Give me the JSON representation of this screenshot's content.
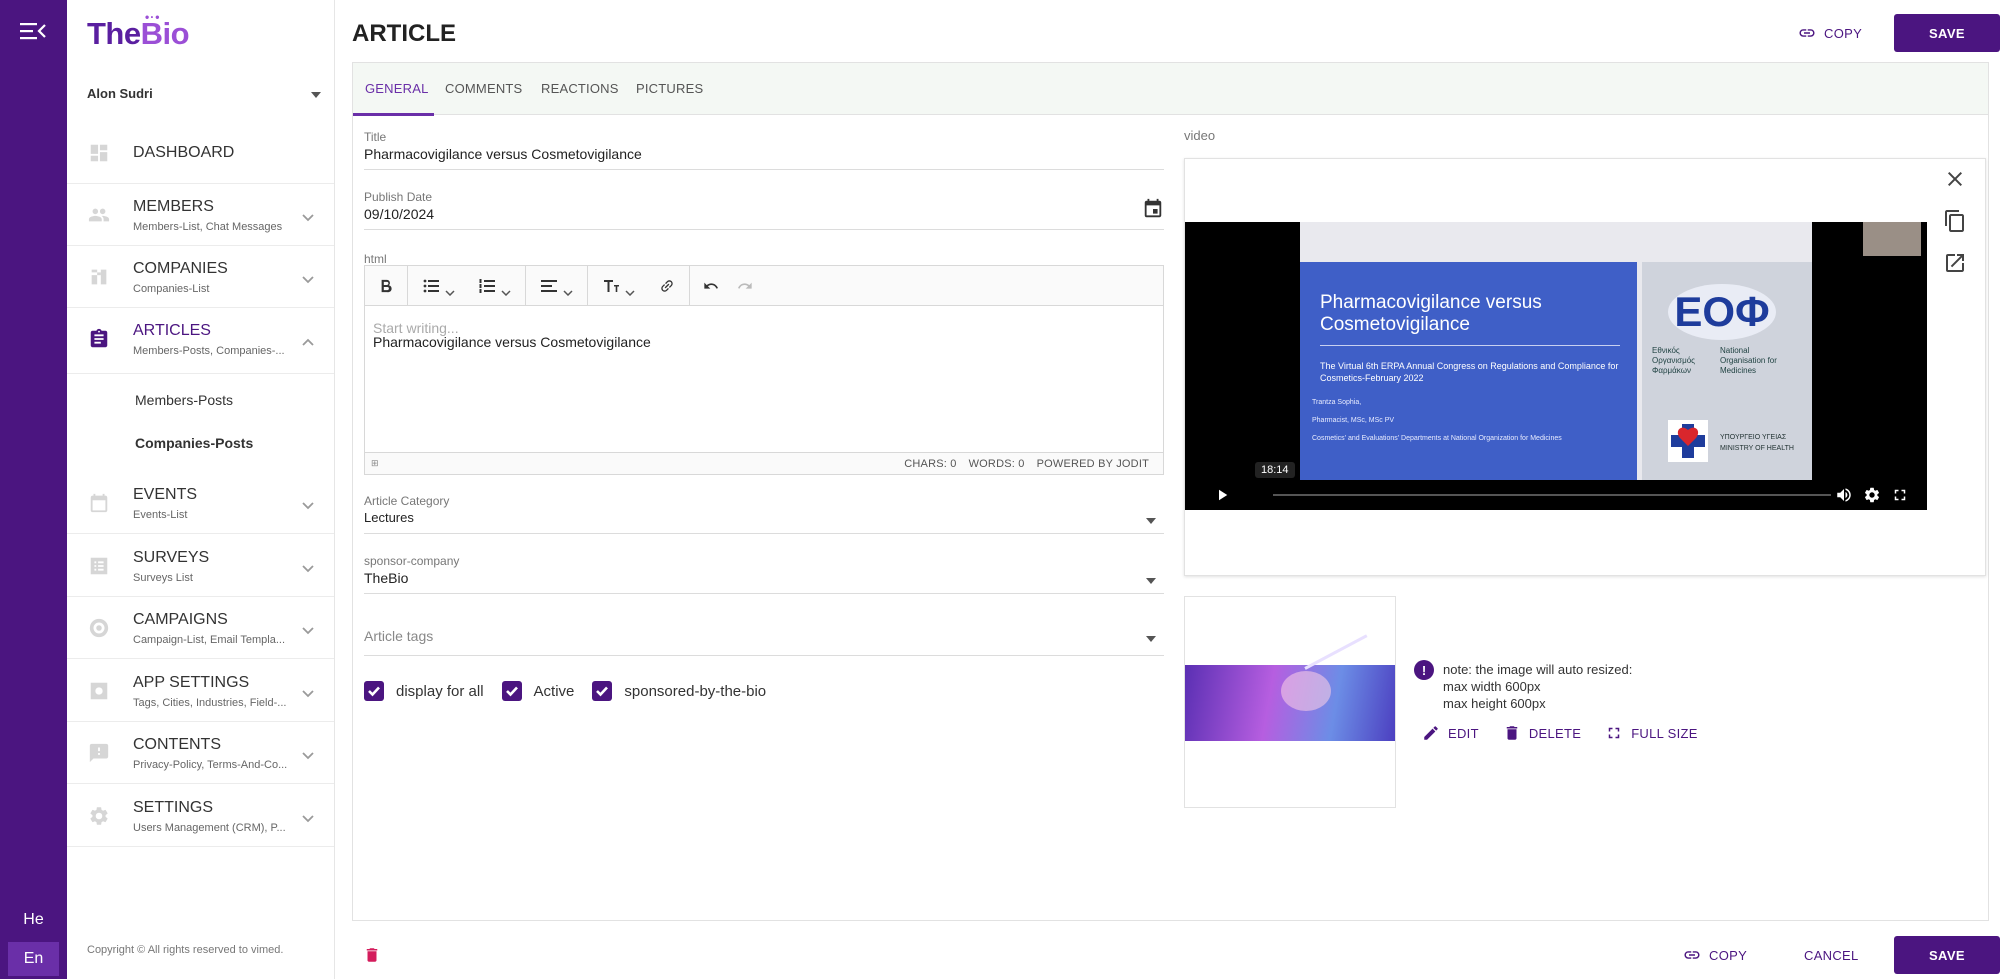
{
  "app": {
    "logo_the": "The",
    "logo_bio": "Bio",
    "user": "Alon Sudri",
    "languages": [
      "He",
      "En"
    ],
    "copyright": "Copyright © All rights reserved to vimed."
  },
  "sidebar": {
    "items": [
      {
        "title": "DASHBOARD",
        "sub": ""
      },
      {
        "title": "MEMBERS",
        "sub": "Members-List, Chat Messages"
      },
      {
        "title": "COMPANIES",
        "sub": "Companies-List"
      },
      {
        "title": "ARTICLES",
        "sub": "Members-Posts, Companies-..."
      },
      {
        "title": "EVENTS",
        "sub": "Events-List"
      },
      {
        "title": "SURVEYS",
        "sub": "Surveys List"
      },
      {
        "title": "CAMPAIGNS",
        "sub": "Campaign-List, Email Templa..."
      },
      {
        "title": "APP SETTINGS",
        "sub": "Tags, Cities, Industries, Field-..."
      },
      {
        "title": "CONTENTS",
        "sub": "Privacy-Policy, Terms-And-Co..."
      },
      {
        "title": "SETTINGS",
        "sub": "Users Management (CRM), P..."
      }
    ],
    "articles_sub": [
      "Members-Posts",
      "Companies-Posts"
    ]
  },
  "page": {
    "title": "ARTICLE",
    "copy_label": "COPY",
    "save_label": "SAVE",
    "cancel_label": "CANCEL"
  },
  "tabs": [
    "GENERAL",
    "COMMENTS",
    "REACTIONS",
    "PICTURES"
  ],
  "form": {
    "title_label": "Title",
    "title_value": "Pharmacovigilance versus Cosmetovigilance",
    "date_label": "Publish Date",
    "date_value": "09/10/2024",
    "html_label": "html",
    "editor_placeholder": "Start writing...",
    "editor_content": "Pharmacovigilance versus Cosmetovigilance",
    "chars": "CHARS: 0",
    "words": "WORDS: 0",
    "powered": "POWERED BY JODIT",
    "category_label": "Article Category",
    "category_value": "Lectures",
    "sponsor_label": "sponsor-company",
    "sponsor_value": "TheBio",
    "tags_placeholder": "Article tags",
    "checkboxes": [
      {
        "label": "display for all",
        "checked": true
      },
      {
        "label": "Active",
        "checked": true
      },
      {
        "label": "sponsored-by-the-bio",
        "checked": true
      }
    ]
  },
  "video": {
    "label": "video",
    "time": "18:14",
    "slide_title": "Pharmacovigilance versus Cosmetovigilance",
    "slide_sub": "The Virtual 6th ERPA Annual Congress on Regulations and Compliance for Cosmetics-February 2022",
    "slide_author": "Trantza Sophia,",
    "slide_role": "Pharmacist, MSc, MSc PV",
    "slide_dept": "Cosmetics' and Evaluations' Departments at National Organization for Medicines",
    "eof": "ΕΟΦ",
    "eof_gr": "Εθνικός Οργανισμός Φαρμάκων",
    "eof_en": "National Organisation for Medicines",
    "ministry_gr": "ΥΠΟΥΡΓΕΙΟ ΥΓΕΙΑΣ",
    "ministry_en": "MINISTRY OF HEALTH"
  },
  "image": {
    "note_line1": "note: the image will auto resized:",
    "note_line2": "max width 600px",
    "note_line3": "max height 600px",
    "edit": "EDIT",
    "delete": "DELETE",
    "full": "FULL SIZE"
  }
}
